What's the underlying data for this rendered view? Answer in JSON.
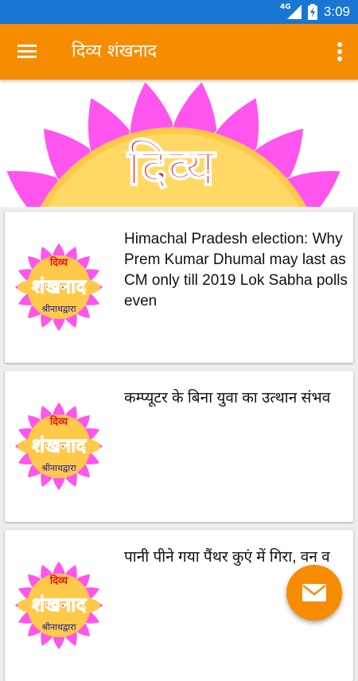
{
  "status_bar": {
    "network": "4G",
    "time": "3:09"
  },
  "toolbar": {
    "title": "दिव्य शंखनाद",
    "menu_icon": "hamburger-menu-icon",
    "more_icon": "more-vert-icon"
  },
  "banner": {
    "logo_text": "दिव्य"
  },
  "logo": {
    "line1": "दिव्य",
    "line2": "शंखनाद",
    "line3": "श्रीनाथद्वारा"
  },
  "articles": [
    {
      "headline": "Himachal Pradesh election: Why Prem Kumar Dhumal may last as CM only till 2019 Lok Sabha polls even"
    },
    {
      "headline": "कम्प्यूटर के बिना युवा का उत्थान संभव"
    },
    {
      "headline": " पानी पीने गया पैंथर कुएं में गिरा, वन व"
    }
  ],
  "fab": {
    "icon": "mail-icon"
  },
  "colors": {
    "status_bar": "#1976d2",
    "toolbar": "#f78c00",
    "petal": "#ff55ee",
    "logo_center": "#ffc94a",
    "logo_text": "#e4141b"
  }
}
